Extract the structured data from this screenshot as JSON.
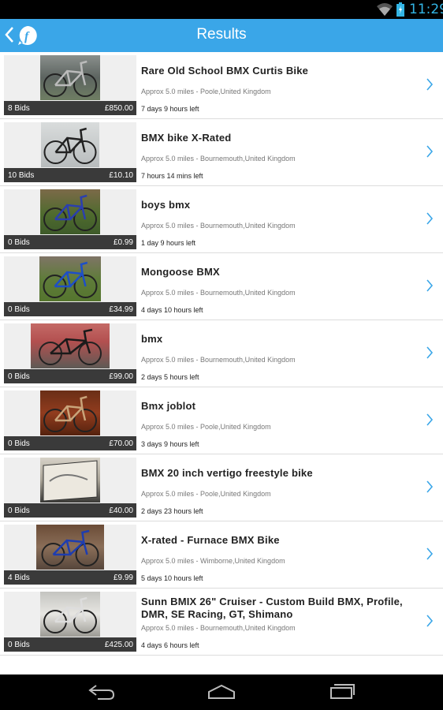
{
  "status_bar": {
    "time": "11:29",
    "wifi_icon": "wifi-icon",
    "battery_icon": "battery-icon"
  },
  "action_bar": {
    "title": "Results",
    "back_icon": "back-chevron-icon",
    "app_logo": "app-logo-icon"
  },
  "colors": {
    "accent": "#3aa6e8",
    "status_text": "#33b5e5",
    "chevron": "#3aa6e8",
    "price_bar": "#3a3a3a"
  },
  "listings": [
    {
      "title": "Rare Old School BMX Curtis Bike",
      "location": "Approx 5.0 miles - Poole,United Kingdom",
      "time_left": "7 days 9 hours left",
      "bids": "8 Bids",
      "price": "£850.00",
      "photo": "bmx-bike-photo"
    },
    {
      "title": "BMX bike X-Rated",
      "location": "Approx 5.0 miles - Bournemouth,United Kingdom",
      "time_left": "7 hours 14 mins left",
      "bids": "10 Bids",
      "price": "£10.10",
      "photo": "bmx-bike-photo"
    },
    {
      "title": "boys bmx",
      "location": "Approx 5.0 miles - Bournemouth,United Kingdom",
      "time_left": "1 day 9 hours left",
      "bids": "0 Bids",
      "price": "£0.99",
      "photo": "bmx-bike-photo"
    },
    {
      "title": "Mongoose BMX",
      "location": "Approx 5.0 miles - Bournemouth,United Kingdom",
      "time_left": "4 days 10 hours left",
      "bids": "0 Bids",
      "price": "£34.99",
      "photo": "bmx-bike-photo"
    },
    {
      "title": "bmx",
      "location": "Approx 5.0 miles - Bournemouth,United Kingdom",
      "time_left": "2 days 5 hours left",
      "bids": "0 Bids",
      "price": "£99.00",
      "photo": "bmx-bike-photo"
    },
    {
      "title": "Bmx joblot",
      "location": "Approx 5.0 miles - Poole,United Kingdom",
      "time_left": "3 days 9 hours left",
      "bids": "0 Bids",
      "price": "£70.00",
      "photo": "bmx-bike-photo"
    },
    {
      "title": "BMX 20 inch vertigo freestyle bike",
      "location": "Approx 5.0 miles - Poole,United Kingdom",
      "time_left": "2 days 23 hours left",
      "bids": "0 Bids",
      "price": "£40.00",
      "photo": "bike-box-photo"
    },
    {
      "title": "X-rated - Furnace BMX Bike",
      "location": "Approx 5.0 miles - Wimborne,United Kingdom",
      "time_left": "5 days 10 hours left",
      "bids": "4 Bids",
      "price": "£9.99",
      "photo": "bmx-bike-photo"
    },
    {
      "title": "Sunn BMIX 26\" Cruiser - Custom Build BMX, Profile, DMR, SE Racing, GT, Shimano",
      "location": "Approx 5.0 miles - Bournemouth,United Kingdom",
      "time_left": "4 days 6 hours left",
      "bids": "0 Bids",
      "price": "£425.00",
      "photo": "bmx-bike-photo"
    }
  ],
  "nav_bar": {
    "back": "nav-back-icon",
    "home": "nav-home-icon",
    "recents": "nav-recents-icon"
  }
}
